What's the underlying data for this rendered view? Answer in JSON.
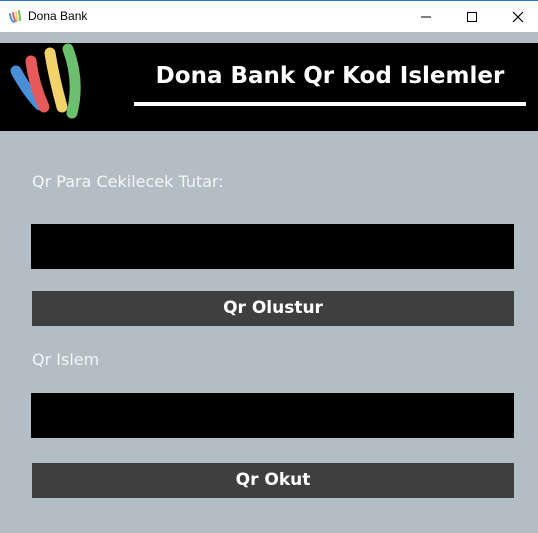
{
  "window": {
    "title": "Dona Bank",
    "controls": [
      "minimize-icon",
      "maximize-icon",
      "close-icon"
    ]
  },
  "header": {
    "title": "Dona Bank Qr Kod Islemler",
    "logo": "dona-bank-logo",
    "logo_colors": [
      "#4a90d9",
      "#e85a5a",
      "#f2d36b",
      "#6cbf6c"
    ]
  },
  "form": {
    "amount_label": "Qr Para Cekilecek Tutar:",
    "amount_value": "",
    "generate_button": "Qr Olustur",
    "qr_label": "Qr Islem",
    "qr_value": "",
    "scan_button": "Qr Okut"
  },
  "colors": {
    "background": "#b3bec4",
    "header_bg": "#000000",
    "button_bg": "#3f3f3f",
    "entry_bg": "#000000"
  }
}
